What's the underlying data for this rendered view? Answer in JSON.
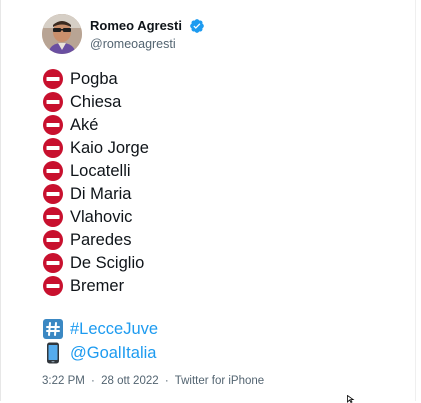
{
  "author": {
    "display_name": "Romeo Agresti",
    "handle": "@romeoagresti"
  },
  "players": [
    "Pogba",
    "Chiesa",
    "Aké",
    "Kaio Jorge",
    "Locatelli",
    "Di Maria",
    "Vlahovic",
    "Paredes",
    "De Sciglio",
    "Bremer"
  ],
  "links": {
    "hashtag": "#LecceJuve",
    "mention": "@GoalItalia"
  },
  "meta": {
    "time": "3:22 PM",
    "sep1": "·",
    "date": "28 ott 2022",
    "sep2": "·",
    "source": "Twitter for iPhone"
  },
  "icons": {
    "no_entry": "no-entry-icon",
    "hashtag": "hash-keycap-icon",
    "mention": "mobile-phone-icon",
    "verified": "verified-badge-icon"
  },
  "colors": {
    "no_entry_red": "#c8102e",
    "link_blue": "#1d9bf0",
    "verified_blue": "#1d9bf0",
    "meta_gray": "#536471"
  }
}
